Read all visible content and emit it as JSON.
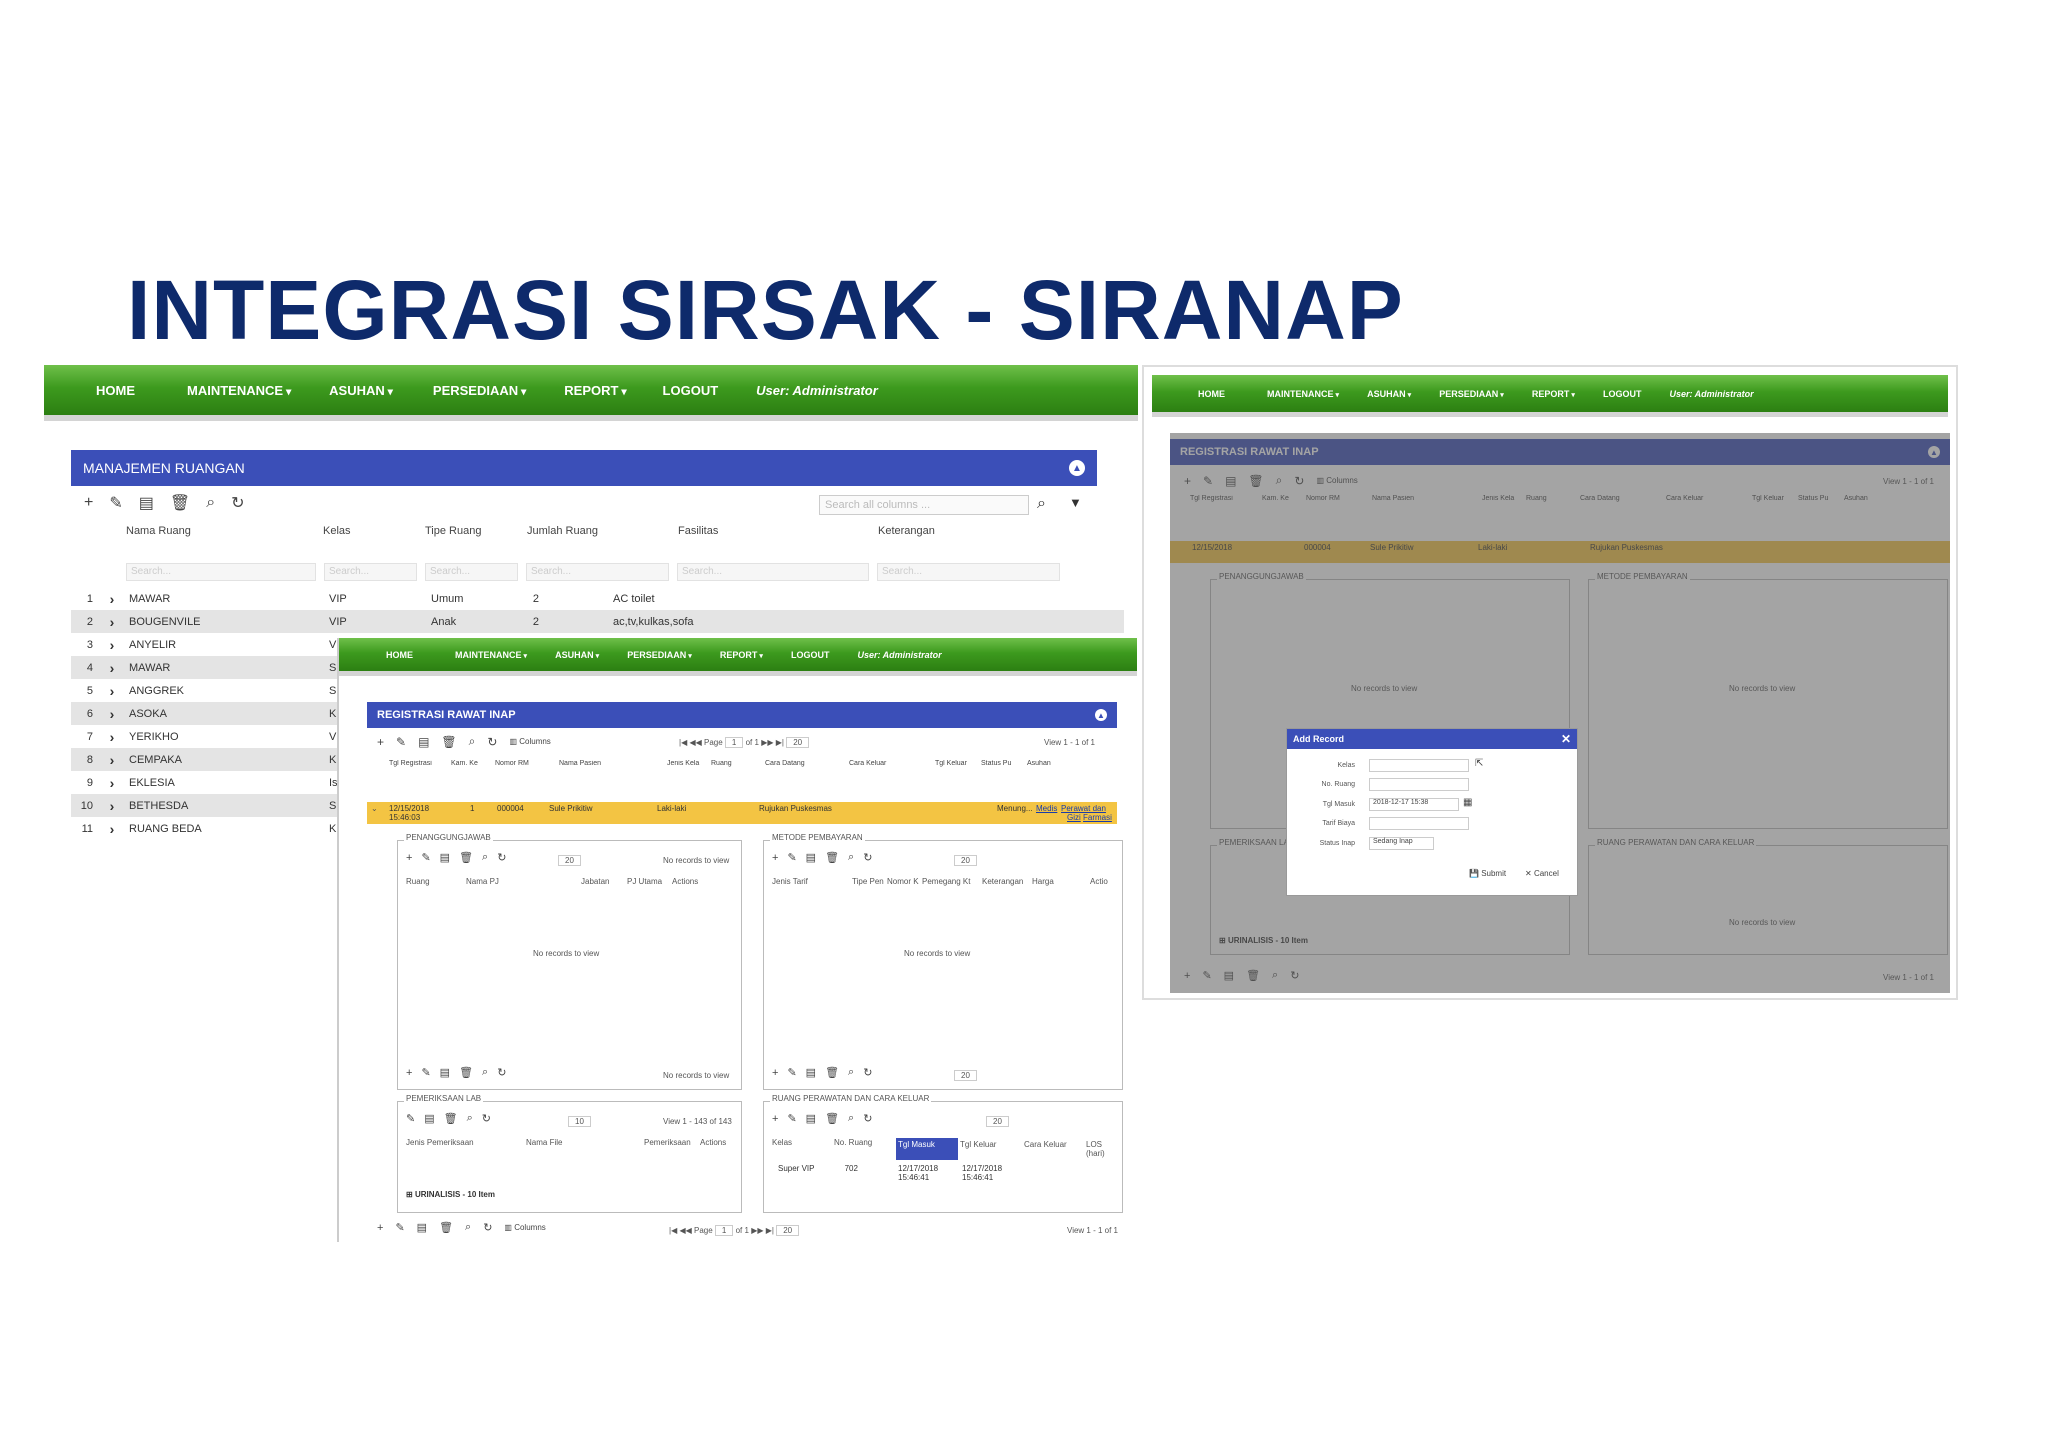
{
  "slide": {
    "title": "INTEGRASI SIRSAK - SIRANAP"
  },
  "nav": {
    "home": "HOME",
    "maintenance": "MAINTENANCE",
    "asuhan": "ASUHAN",
    "persediaan": "PERSEDIAAN",
    "report": "REPORT",
    "logout": "LOGOUT",
    "user": "User: Administrator"
  },
  "ruangan": {
    "title": "MANAJEMEN RUANGAN",
    "search_all_placeholder": "Search all columns ...",
    "columns": [
      "Nama Ruang",
      "Kelas",
      "Tipe Ruang",
      "Jumlah Ruang",
      "Fasilitas",
      "Keterangan"
    ],
    "search_placeholder": "Search...",
    "rows": [
      {
        "no": "1",
        "nama": "MAWAR",
        "kelas": "VIP",
        "tipe": "Umum",
        "jumlah": "2",
        "fasilitas": "AC toilet"
      },
      {
        "no": "2",
        "nama": "BOUGENVILE",
        "kelas": "VIP",
        "tipe": "Anak",
        "jumlah": "2",
        "fasilitas": "ac,tv,kulkas,sofa"
      },
      {
        "no": "3",
        "nama": "ANYELIR",
        "kelas": "VI",
        "tipe": "",
        "jumlah": "",
        "fasilitas": ""
      },
      {
        "no": "4",
        "nama": "MAWAR",
        "kelas": "S",
        "tipe": "",
        "jumlah": "",
        "fasilitas": ""
      },
      {
        "no": "5",
        "nama": "ANGGREK",
        "kelas": "S",
        "tipe": "",
        "jumlah": "",
        "fasilitas": ""
      },
      {
        "no": "6",
        "nama": "ASOKA",
        "kelas": "K",
        "tipe": "",
        "jumlah": "",
        "fasilitas": ""
      },
      {
        "no": "7",
        "nama": "YERIKHO",
        "kelas": "VI",
        "tipe": "",
        "jumlah": "",
        "fasilitas": ""
      },
      {
        "no": "8",
        "nama": "CEMPAKA",
        "kelas": "K",
        "tipe": "",
        "jumlah": "",
        "fasilitas": ""
      },
      {
        "no": "9",
        "nama": "EKLESIA",
        "kelas": "Is",
        "tipe": "",
        "jumlah": "",
        "fasilitas": ""
      },
      {
        "no": "10",
        "nama": "BETHESDA",
        "kelas": "S",
        "tipe": "",
        "jumlah": "",
        "fasilitas": ""
      },
      {
        "no": "11",
        "nama": "RUANG BEDA",
        "kelas": "K",
        "tipe": "",
        "jumlah": "",
        "fasilitas": ""
      }
    ]
  },
  "rawat": {
    "title": "REGISTRASI RAWAT INAP",
    "columns_btn": "Columns",
    "page_label": "Page",
    "page_value": "1",
    "of_label": "of 1",
    "per_page": "20",
    "view_label": "View 1 - 1 of 1",
    "columns": [
      "Tgl Registrasi",
      "Kam. Ke",
      "Nomor RM",
      "Nama Pasien",
      "Jenis Kela",
      "Ruang",
      "Cara Datang",
      "Cara Keluar",
      "Tgl Keluar",
      "Status Pu",
      "Asuhan"
    ],
    "row": {
      "tgl": "12/15/2018",
      "jam": "15:46:03",
      "kam": "1",
      "rm": "000004",
      "nama": "Sule Prikitiw",
      "jk": "Laki-laki",
      "cara_datang": "Rujukan Puskesmas",
      "status": "Menung...",
      "links": [
        "Medis",
        "Perawat dan",
        "Gizi",
        "Farmasi"
      ]
    },
    "penanggung": {
      "legend": "PENANGGUNGJAWAB",
      "cols": [
        "Ruang",
        "Nama PJ",
        "Jabatan",
        "PJ Utama",
        "Actions"
      ],
      "empty": "No records to view",
      "per_page": "20"
    },
    "metode": {
      "legend": "METODE PEMBAYARAN",
      "cols": [
        "Jenis Tarif",
        "Tipe Pen",
        "Nomor K",
        "Pemegang Kt",
        "Keterangan",
        "Harga",
        "Actio"
      ],
      "empty": "No records to view",
      "per_page": "20"
    },
    "lab": {
      "legend": "PEMERIKSAAN LAB",
      "cols": [
        "Jenis Pemeriksaan",
        "Nama File",
        "Pemeriksaan",
        "Actions"
      ],
      "per_page": "10",
      "view": "View 1 - 143 of 143",
      "group": "URINALISIS - 10 Item"
    },
    "ruang_perawatan": {
      "legend": "RUANG PERAWATAN DAN CARA KELUAR",
      "cols": [
        "Kelas",
        "No. Ruang",
        "Tgl Masuk",
        "Tgl Keluar",
        "Cara Keluar",
        "LOS (hari)"
      ],
      "per_page": "20",
      "row": {
        "kelas": "Super VIP",
        "no": "702",
        "masuk": "12/17/2018 15:46:41",
        "keluar": "12/17/2018 15:46:41"
      }
    }
  },
  "modal": {
    "title": "Add Record",
    "fields": {
      "kelas": "Kelas",
      "no_ruang": "No. Ruang",
      "tgl_masuk": "Tgl Masuk",
      "tarif": "Tarif Biaya",
      "status": "Status Inap"
    },
    "values": {
      "tgl_masuk": "2018-12-17 15:38",
      "status": "Sedang Inap"
    },
    "submit": "Submit",
    "cancel": "Cancel"
  }
}
